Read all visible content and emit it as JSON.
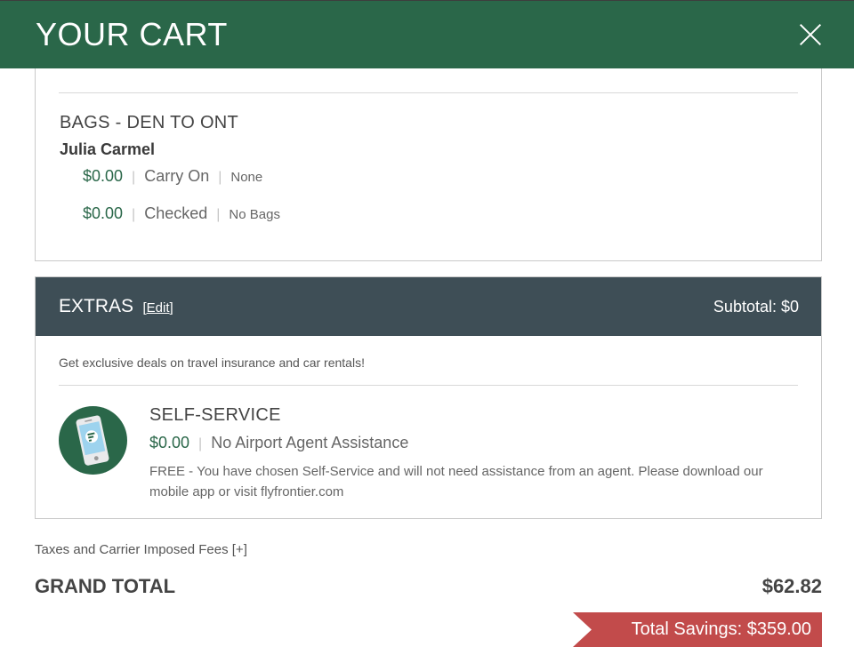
{
  "header": {
    "title": "YOUR CART",
    "close_icon": "close-icon"
  },
  "bags": {
    "title": "BAGS - DEN TO ONT",
    "passenger": "Julia Carmel",
    "items": [
      {
        "price": "$0.00",
        "type": "Carry On",
        "detail": "None"
      },
      {
        "price": "$0.00",
        "type": "Checked",
        "detail": "No Bags"
      }
    ]
  },
  "extras": {
    "title": "EXTRAS",
    "edit_open": "[",
    "edit_label": "Edit",
    "edit_close": "]",
    "subtotal": "Subtotal: $0",
    "deals_text": "Get exclusive deals on travel insurance and car rentals!",
    "self_service": {
      "icon": "mobile-phone-icon",
      "title": "SELF-SERVICE",
      "price": "$0.00",
      "description": "No Airport Agent Assistance",
      "note": "FREE - You have chosen Self-Service and will not need assistance from an agent. Please download our mobile app or visit flyfrontier.com"
    }
  },
  "summary": {
    "taxes_link": "Taxes and Carrier Imposed Fees [+]",
    "grand_total_label": "GRAND TOTAL",
    "grand_total_value": "$62.82",
    "savings": "Total Savings: $359.00"
  },
  "colors": {
    "brand_green": "#2a6749",
    "extras_header": "#3e4e56",
    "savings_red": "#c24b4b"
  }
}
